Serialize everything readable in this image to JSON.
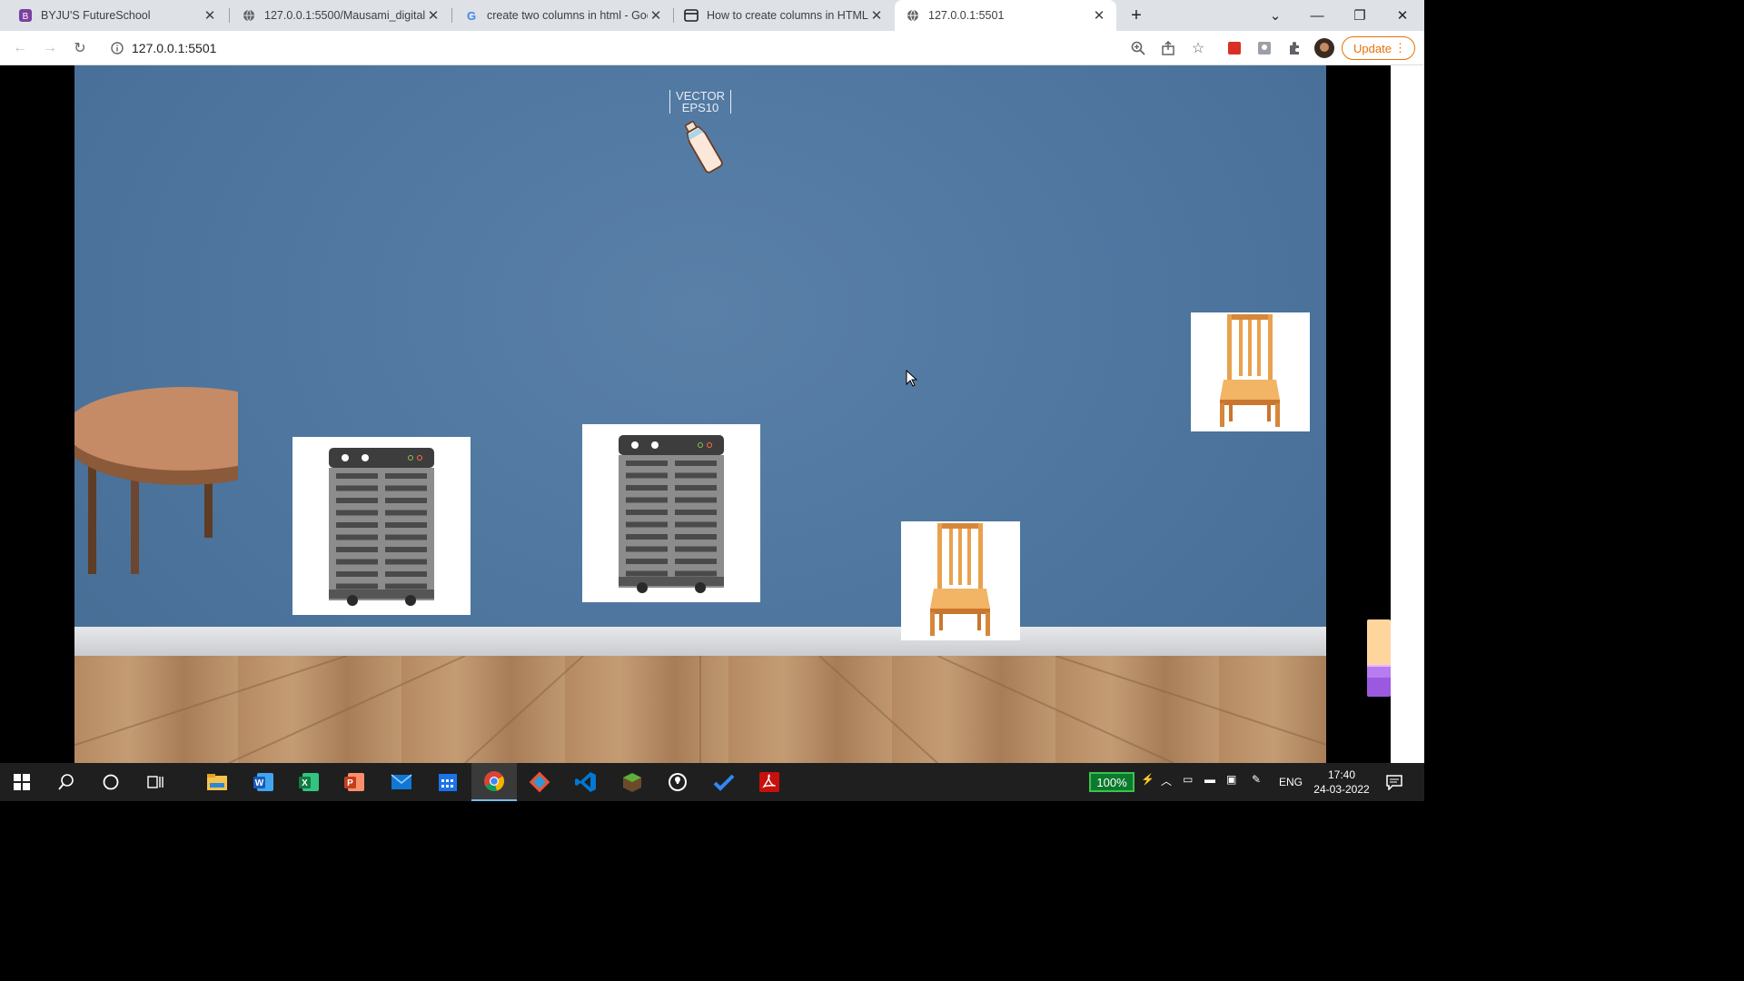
{
  "browser": {
    "tabs": [
      {
        "title": "BYJU'S FutureSchool",
        "icon": "byjus-icon"
      },
      {
        "title": "127.0.0.1:5500/Mausami_digital_r",
        "icon": "globe-icon"
      },
      {
        "title": "create two columns in html - Goo",
        "icon": "google-icon"
      },
      {
        "title": "How to create columns in HTML",
        "icon": "page-icon"
      },
      {
        "title": "127.0.0.1:5501",
        "icon": "globe-icon",
        "active": true
      }
    ],
    "new_tab_label": "+",
    "url": "127.0.0.1:5501",
    "update_label": "Update"
  },
  "page": {
    "bottle_watermark": [
      "VECTOR",
      "EPS10"
    ],
    "colors": {
      "wall": "#4f77a0",
      "floor": "#b58a63",
      "table_top": "#c58b66",
      "chair": "#e8a14e",
      "heater": "#7c7c7c"
    }
  },
  "taskbar": {
    "battery": "100%",
    "language": "ENG",
    "time": "17:40",
    "date": "24-03-2022"
  }
}
